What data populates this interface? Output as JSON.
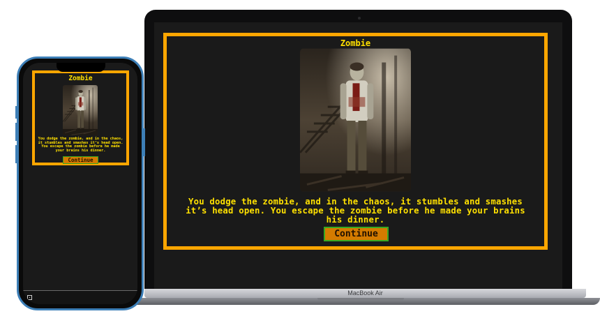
{
  "device_label": "MacBook Air",
  "scene": {
    "title": "Zombie",
    "image_alt": "zombie-illustration",
    "story": "You dodge the zombie, and in the chaos, it stumbles and smashes it’s head open. You escape the zombie before he made your brains his dinner.",
    "continue_label": "Continue"
  },
  "colors": {
    "frame": "#ffa600",
    "title": "#ffe000",
    "button_bg": "#d47b00",
    "button_border": "#38a820",
    "screen_bg": "#1a1a1a"
  }
}
